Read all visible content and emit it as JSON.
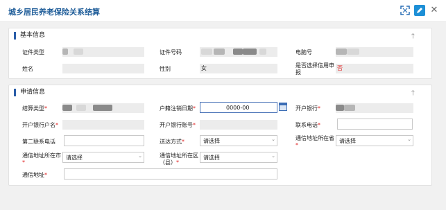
{
  "window": {
    "title": "城乡居民养老保险关系结算"
  },
  "basic": {
    "section_title": "基本信息",
    "labels": [
      "证件类型",
      "证件号码",
      "电脑号",
      "姓名",
      "性别",
      "是否选择信用申报"
    ],
    "gender": "女",
    "credit": "否"
  },
  "apply": {
    "section_title": "申请信息",
    "settle_type": "结算类型",
    "cancel_date": "户籍注销日期",
    "cancel_date_value": "0000-00",
    "bank": "开户银行",
    "bank_account_name": "开户银行户名",
    "bank_account_no": "开户银行账号",
    "phone": "联系电话",
    "phone2": "第二联系电话",
    "delivery": "送达方式",
    "province": "通信地址所在省",
    "city": "通信地址所在市",
    "district": "通信地址所在区（县）",
    "address": "通信地址",
    "select_placeholder": "请选择",
    "required_mark": "*"
  }
}
